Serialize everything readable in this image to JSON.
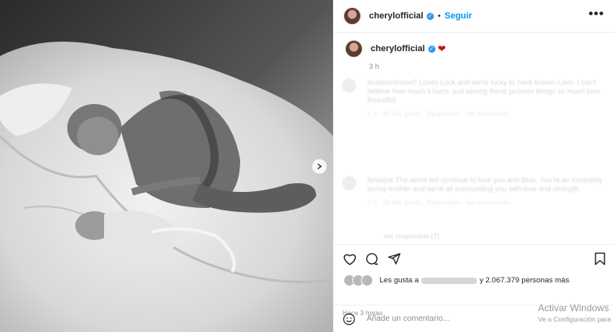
{
  "post": {
    "username": "cherylofficial",
    "follow_label": "Seguir",
    "more_label": "•••",
    "caption_time": "3 h",
    "likes_prefix": "Les gusta a",
    "likes_suffix": "y 2.067.379 personas más",
    "posted_ago": "Hace 3 horas",
    "comment_placeholder": "Añade un comentario..."
  },
  "comments": [
    {
      "text": "louistomlinson7 Loves Luck and we're lucky to have known Liam. I can't believe how much it hurts, just seeing these pictures brings so much love. Beautiful. ",
      "meta": "1 h · 40 Me gusta · Responder · Ver traducción"
    },
    {
      "text": "ferdajoe The world will continue to love you and Bear. You're an incredibly loving mother and we're all surrounding you with love and strength.",
      "meta": "2 h · 38 Me gusta · Responder · Ver traducción"
    }
  ],
  "view_replies": "Ver respuestas (7)",
  "watermark": {
    "line1": "Activar Windows",
    "line2": "Ve a Configuración para"
  },
  "icons": [
    "heart-icon",
    "comment-icon",
    "share-icon",
    "bookmark-icon",
    "emoji-icon",
    "verified-icon",
    "chevron-right-icon",
    "more-icon"
  ]
}
